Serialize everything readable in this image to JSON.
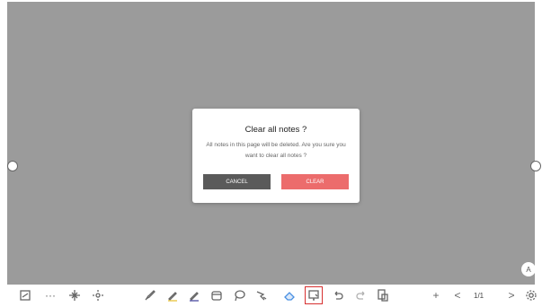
{
  "dialog": {
    "title": "Clear all notes ?",
    "message": "All notes in this page will be deleted. Are you sure you want to clear all notes ?",
    "cancel_label": "CANCEL",
    "clear_label": "CLEAR"
  },
  "toolbar": {
    "page_indicator": "1/1",
    "more_label": "···",
    "add_label": "+",
    "prev_label": "<",
    "next_label": ">",
    "user_label": "A",
    "icons": [
      "exit-whiteboard-icon",
      "more-icon",
      "move-icon",
      "pan-icon",
      "brush-icon",
      "highlighter-pen-icon",
      "pen-icon",
      "shape-icon",
      "lasso-icon",
      "select-icon",
      "eraser-icon",
      "clear-screen-icon",
      "undo-icon",
      "redo-icon",
      "page-list-icon",
      "add-page-icon",
      "previous-page-icon",
      "next-page-icon",
      "settings-icon"
    ]
  },
  "colors": {
    "board": "#9b9b9b",
    "clear_button": "#ec6c6c",
    "cancel_button": "#5a5a5a",
    "selected_tool": "#4a90e2",
    "highlight_outline": "#d73030"
  }
}
